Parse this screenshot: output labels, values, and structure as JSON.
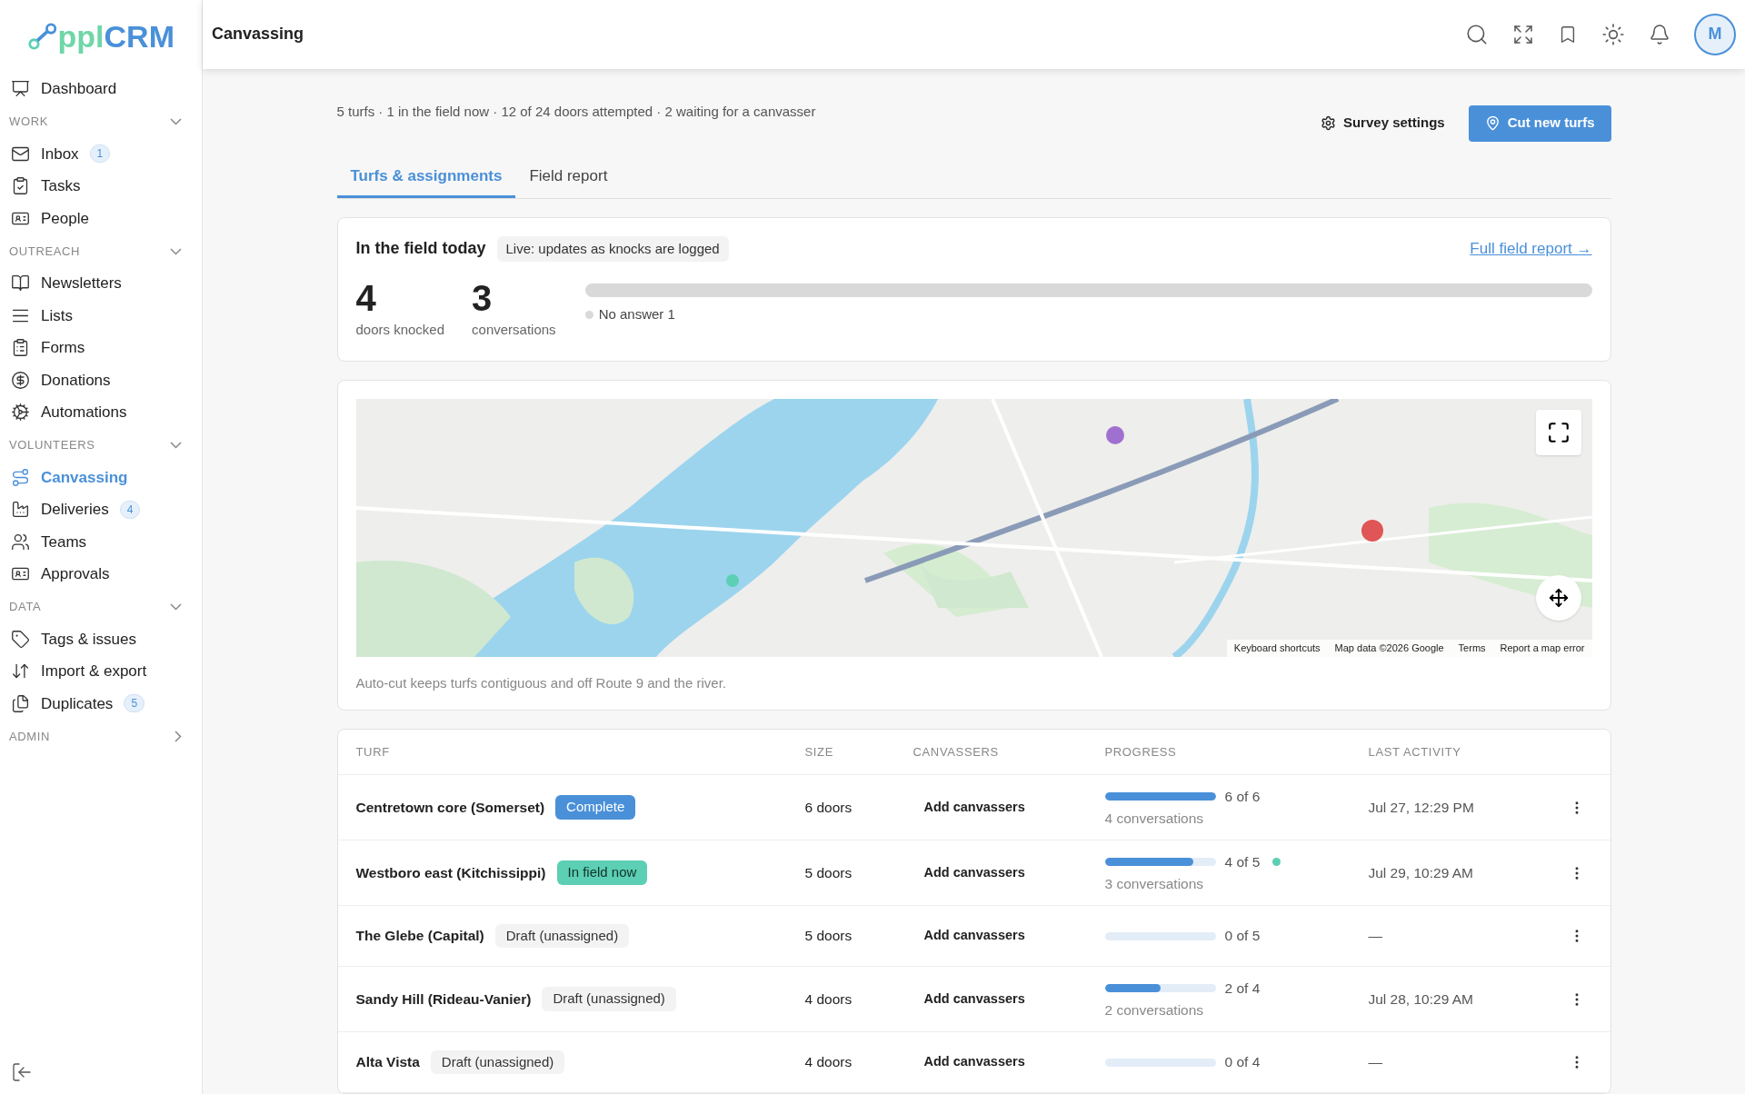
{
  "logo": {
    "first": "ppl",
    "second": "CRM"
  },
  "sidebar": {
    "items": [
      {
        "label": "Dashboard",
        "selected": false
      }
    ],
    "sections": [
      {
        "title": "WORK",
        "expanded": true,
        "items": [
          {
            "label": "Inbox",
            "badge": "1",
            "selected": false
          },
          {
            "label": "Tasks",
            "selected": false
          },
          {
            "label": "People",
            "selected": false
          }
        ]
      },
      {
        "title": "OUTREACH",
        "expanded": true,
        "items": [
          {
            "label": "Newsletters",
            "selected": false
          },
          {
            "label": "Lists",
            "selected": false
          },
          {
            "label": "Forms",
            "selected": false
          },
          {
            "label": "Donations",
            "selected": false
          },
          {
            "label": "Automations",
            "selected": false
          }
        ]
      },
      {
        "title": "VOLUNTEERS",
        "expanded": true,
        "items": [
          {
            "label": "Canvassing",
            "selected": true
          },
          {
            "label": "Deliveries",
            "badge": "4",
            "selected": false
          },
          {
            "label": "Teams",
            "selected": false
          },
          {
            "label": "Approvals",
            "selected": false
          }
        ]
      },
      {
        "title": "DATA",
        "expanded": true,
        "items": [
          {
            "label": "Tags & issues",
            "selected": false
          },
          {
            "label": "Import & export",
            "selected": false
          },
          {
            "label": "Duplicates",
            "badge": "5",
            "selected": false
          }
        ]
      },
      {
        "title": "ADMIN",
        "expanded": false
      }
    ]
  },
  "header": {
    "title": "Canvassing",
    "avatar": "M"
  },
  "summary": "5 turfs · 1 in the field now · 12 of 24 doors attempted · 2 waiting for a canvasser",
  "actions": {
    "secondary": "Survey settings",
    "primary": "Cut new turfs"
  },
  "tabs": [
    {
      "label": "Turfs & assignments",
      "selected": true
    },
    {
      "label": "Field report",
      "selected": false
    }
  ],
  "field_today": {
    "title": "In the field today",
    "live_badge": "Live: updates as knocks are logged",
    "link": "Full field report →",
    "stats": [
      {
        "value": "4",
        "label": "doors knocked"
      },
      {
        "value": "3",
        "label": "conversations"
      }
    ],
    "legend": [
      {
        "label": "No answer 1",
        "color": "#d9d9d9",
        "level": 1
      }
    ]
  },
  "map": {
    "attribution": [
      "Keyboard shortcuts",
      "Map data ©2026 Google",
      "Terms",
      "Report a map error"
    ],
    "note": "Auto-cut keeps turfs contiguous and off Route 9 and the river."
  },
  "table": {
    "columns": [
      "TURF",
      "SIZE",
      "CANVASSERS",
      "PROGRESS",
      "LAST ACTIVITY"
    ],
    "rows": [
      {
        "turf": "Centretown core (Somerset)",
        "status": {
          "kind": "complete",
          "label": "Complete"
        },
        "size": "6 doors",
        "canvassers": "Add canvassers",
        "level": 1,
        "progress": "6 of 6",
        "conversations": "4 conversations",
        "live": false,
        "last_activity": "Jul 27, 12:29 PM"
      },
      {
        "turf": "Westboro east (Kitchissippi)",
        "status": {
          "kind": "live",
          "label": "In field now"
        },
        "size": "5 doors",
        "canvassers": "Add canvassers",
        "level": 0.8,
        "progress": "4 of 5",
        "conversations": "3 conversations",
        "live": true,
        "last_activity": "Jul 29, 10:29 AM"
      },
      {
        "turf": "The Glebe (Capital)",
        "status": {
          "kind": "draft",
          "label": "Draft (unassigned)"
        },
        "size": "5 doors",
        "canvassers": "Add canvassers",
        "level": 0,
        "progress": "0 of 5",
        "live": false,
        "last_activity": "—"
      },
      {
        "turf": "Sandy Hill (Rideau-Vanier)",
        "status": {
          "kind": "draft",
          "label": "Draft (unassigned)"
        },
        "size": "4 doors",
        "canvassers": "Add canvassers",
        "level": 0.5,
        "progress": "2 of 4",
        "conversations": "2 conversations",
        "live": false,
        "last_activity": "Jul 28, 10:29 AM"
      },
      {
        "turf": "Alta Vista",
        "status": {
          "kind": "draft",
          "label": "Draft (unassigned)"
        },
        "size": "4 doors",
        "canvassers": "Add canvassers",
        "level": 0,
        "progress": "0 of 4",
        "live": false,
        "last_activity": "—"
      }
    ]
  }
}
